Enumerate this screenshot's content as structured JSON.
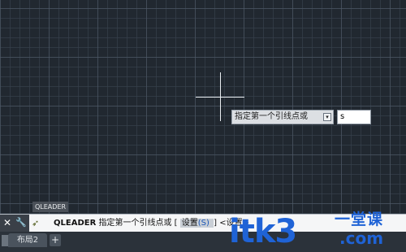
{
  "prompt": {
    "tooltip_text": "指定第一个引线点或",
    "dropdown_symbol": "▾",
    "input_value": "s"
  },
  "command_history": {
    "tag": "QLEADER"
  },
  "command_line": {
    "close_symbol": "✕",
    "settings_symbol": "🔧",
    "icon_symbol": "➶",
    "command": "QLEADER",
    "prompt_text": "指定第一个引线点或",
    "bracket_open": "[",
    "option_label": "设置",
    "option_key": "(S)",
    "bracket_close": "]",
    "default_text": "<设置>"
  },
  "layout_tabs": {
    "items": [
      {
        "label": "布局2"
      }
    ],
    "add_symbol": "+"
  },
  "watermark": {
    "brand": "itk3",
    "slogan": "一堂课",
    "domain": ".com"
  },
  "colors": {
    "canvas": "#212830",
    "watermark": "#1f63d6"
  }
}
